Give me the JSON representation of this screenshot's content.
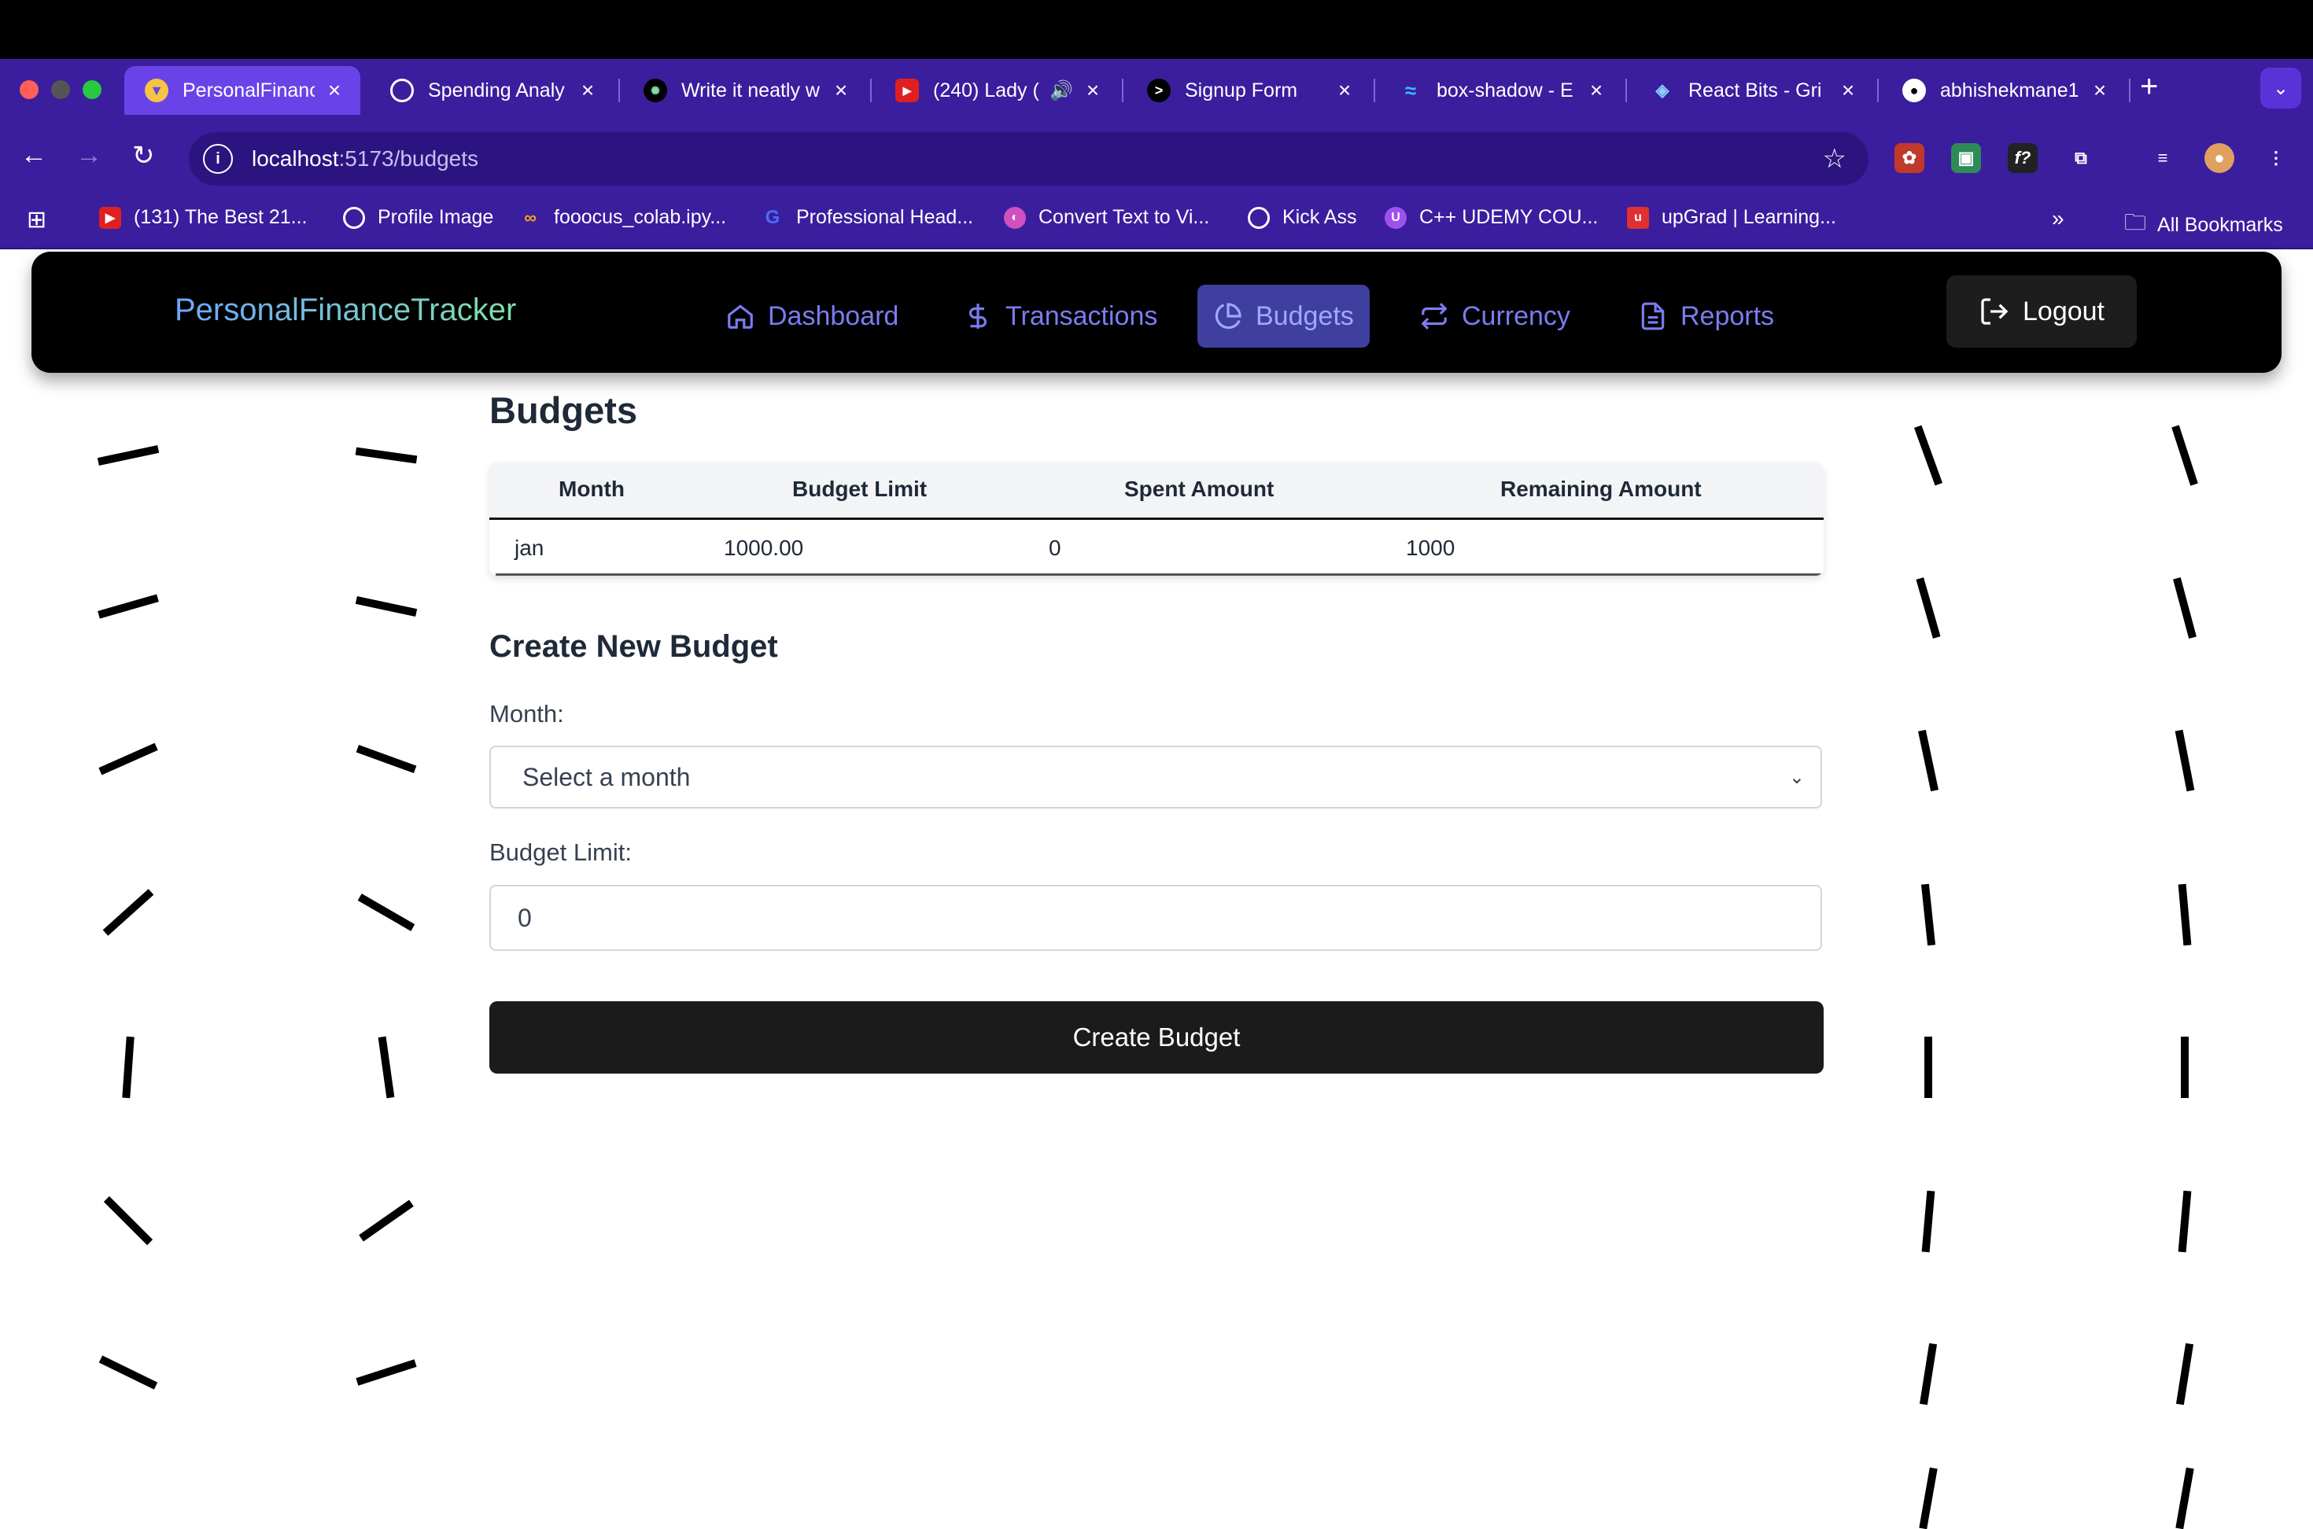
{
  "browser": {
    "tabs": [
      {
        "label": "PersonalFinance",
        "active": true
      },
      {
        "label": "Spending Analy",
        "active": false
      },
      {
        "label": "Write it neatly w",
        "active": false
      },
      {
        "label": "(240) Lady (",
        "active": false
      },
      {
        "label": "Signup Form",
        "active": false
      },
      {
        "label": "box-shadow - E",
        "active": false
      },
      {
        "label": "React Bits - Gri",
        "active": false
      },
      {
        "label": "abhishekmane1",
        "active": false
      }
    ],
    "url_host": "localhost",
    "url_rest": ":5173/budgets",
    "bookmarks": [
      {
        "label": "(131) The Best 21..."
      },
      {
        "label": "Profile Image"
      },
      {
        "label": "fooocus_colab.ipy..."
      },
      {
        "label": "Professional Head..."
      },
      {
        "label": "Convert Text to Vi..."
      },
      {
        "label": "Kick Ass"
      },
      {
        "label": "C++ UDEMY COU..."
      },
      {
        "label": "upGrad | Learning..."
      }
    ],
    "all_bookmarks": "All Bookmarks",
    "overflow": "»"
  },
  "app": {
    "brand": "PersonalFinanceTracker",
    "nav": [
      {
        "label": "Dashboard",
        "icon": "home-icon"
      },
      {
        "label": "Transactions",
        "icon": "dollar-icon"
      },
      {
        "label": "Budgets",
        "icon": "pie-chart-icon",
        "active": true
      },
      {
        "label": "Currency",
        "icon": "swap-icon"
      },
      {
        "label": "Reports",
        "icon": "document-icon"
      }
    ],
    "logout": "Logout"
  },
  "budgets": {
    "title": "Budgets",
    "columns": [
      "Month",
      "Budget Limit",
      "Spent Amount",
      "Remaining Amount"
    ],
    "rows": [
      [
        "jan",
        "1000.00",
        "0",
        "1000"
      ]
    ]
  },
  "form": {
    "title": "Create New Budget",
    "month_label": "Month:",
    "month_selected": "Select a month",
    "limit_label": "Budget Limit:",
    "limit_value": "0",
    "submit": "Create Budget"
  },
  "colors": {
    "browser_chrome": "#3a1e9e",
    "nav_link": "#7b7cf0",
    "button_dark": "#1b1b1b"
  }
}
